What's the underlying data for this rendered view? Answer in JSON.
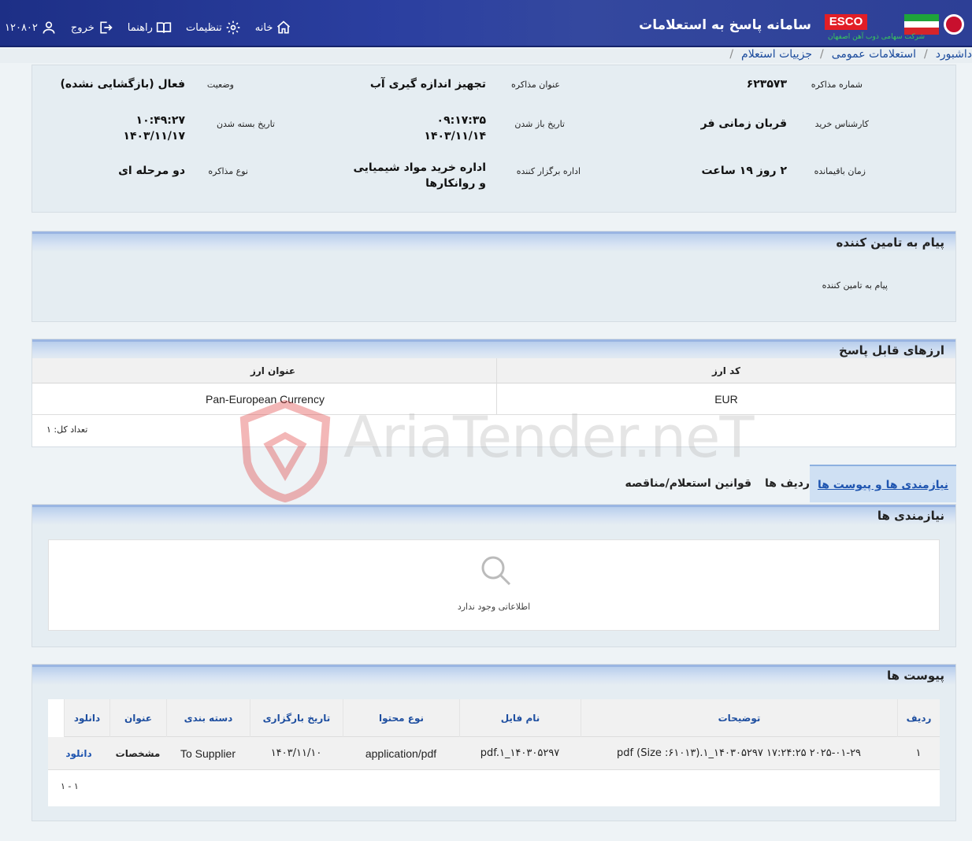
{
  "header": {
    "system_title": "سامانه پاسخ به استعلامات",
    "esco": "ESCO",
    "company_sub": "شرکت سهامی ذوب آهن اصفهان",
    "nav": {
      "home": "خانه",
      "settings": "تنظیمات",
      "guide": "راهنما",
      "logout": "خروج",
      "user_number": "۱۲۰۸۰۲"
    }
  },
  "breadcrumb": [
    "داشبورد",
    "استعلامات عمومی",
    "جزییات استعلام"
  ],
  "info": {
    "tender_number_label": "شماره مذاکره",
    "tender_number": "۶۲۳۵۷۳",
    "title_label": "عنوان مذاکره",
    "title": "تجهیز اندازه گیری آب",
    "status_label": "وضعیت",
    "status": "فعال (بازگشایی نشده)",
    "expert_label": "کارشناس خرید",
    "expert": "قربان زمانی فر",
    "open_date_label": "تاریخ باز شدن",
    "open_time": "۰۹:۱۷:۳۵",
    "open_date": "۱۴۰۳/۱۱/۱۴",
    "close_date_label": "تاریخ بسته شدن",
    "close_time": "۱۰:۴۹:۲۷",
    "close_date": "۱۴۰۳/۱۱/۱۷",
    "remaining_label": "زمان باقیمانده",
    "remaining": "۲ روز ۱۹ ساعت",
    "organizer_label": "اداره برگزار کننده",
    "organizer_line1": "اداره خرید مواد شیمیایی",
    "organizer_line2": "و روانکارها",
    "type_label": "نوع مذاکره",
    "type": "دو مرحله ای"
  },
  "message_panel": {
    "title": "پیام به تامین کننده",
    "label": "پیام به تامین کننده"
  },
  "currencies": {
    "title": "ارزهای قابل پاسخ",
    "columns": [
      "کد ارز",
      "عنوان ارز"
    ],
    "rows": [
      [
        "EUR",
        "Pan-European Currency"
      ]
    ],
    "count": "تعداد کل: ۱"
  },
  "tabs": [
    "نیازمندی ها و پیوست ها",
    "ردیف ها",
    "قوانین استعلام/مناقصه"
  ],
  "needs": {
    "title": "نیازمندی ها",
    "empty": "اطلاعاتی وجود ندارد"
  },
  "attachments": {
    "title": "پیوست ها",
    "columns": [
      "ردیف",
      "توضیحات",
      "نام فایل",
      "نوع محتوا",
      "تاریخ بارگزاری",
      "دسته بندی",
      "عنوان",
      "دانلود"
    ],
    "rows": [
      [
        "۱",
        "pdf (Size :۶۱۰۱۳).۱_۱۴۰۳۰۵۲۹۷ ۱۷:۲۴:۲۵ ۲۰۲۵-۰۱-۲۹",
        "pdf.۱_۱۴۰۳۰۵۲۹۷",
        "application/pdf",
        "۱۴۰۳/۱۱/۱۰",
        "To Supplier",
        "مشخصات",
        "دانلود"
      ]
    ],
    "pager": "۱ - ۱"
  },
  "watermark": "AriaTender.neT"
}
